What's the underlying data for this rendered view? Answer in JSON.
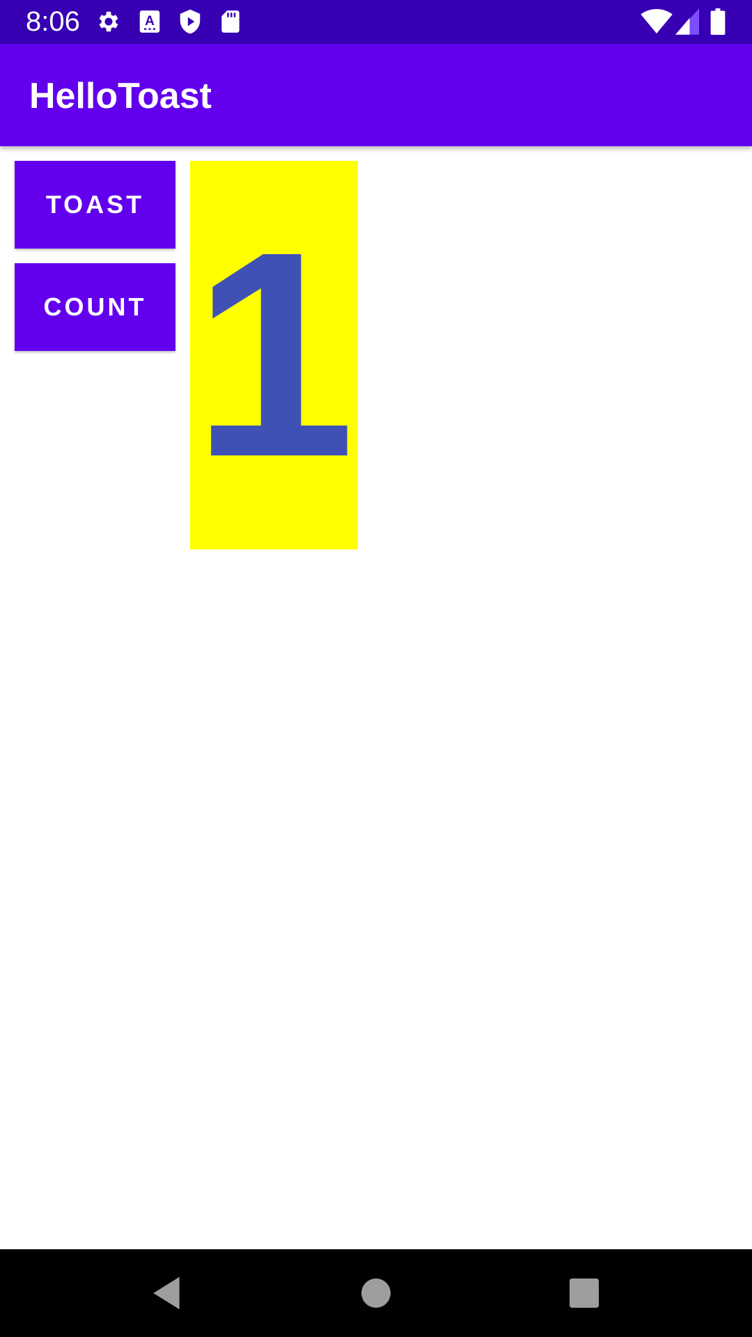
{
  "status_bar": {
    "time": "8:06",
    "icons_left": [
      "settings-icon",
      "text-a-icon",
      "shield-play-icon",
      "sd-card-icon"
    ],
    "icons_right": [
      "wifi-icon",
      "signal-icon",
      "battery-icon"
    ],
    "background": "#3700B3"
  },
  "app_bar": {
    "title": "HelloToast",
    "background": "#6200EE"
  },
  "buttons": {
    "toast_label": "TOAST",
    "count_label": "COUNT",
    "background": "#6200EE"
  },
  "counter": {
    "value": "1",
    "background": "#FFFF00",
    "text_color": "#3F51B5"
  },
  "nav_bar": {
    "buttons": [
      "back-icon",
      "home-icon",
      "recents-icon"
    ]
  }
}
